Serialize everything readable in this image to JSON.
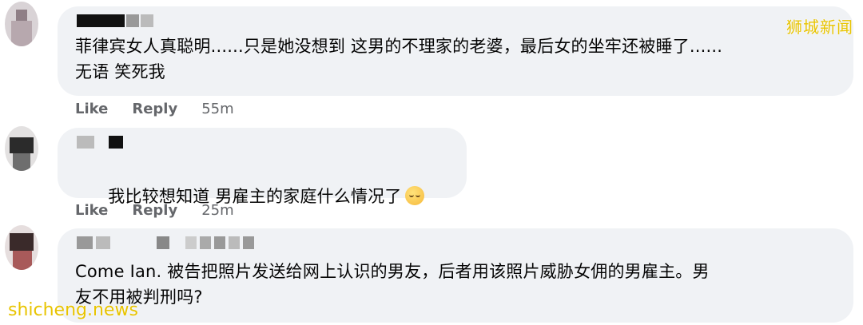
{
  "watermark": {
    "top": "狮城新闻",
    "bottom": "shicheng.news"
  },
  "comments": [
    {
      "text": "菲律宾女人真聪明......只是她没想到 这男的不理家的老婆，最后女的坐牢还被睡了......\n无语 笑死我",
      "actions": {
        "like": "Like",
        "reply": "Reply",
        "time": "55m"
      }
    },
    {
      "text": "我比较想知道 男雇主的家庭什么情况了",
      "emoji": "relieved-face-emoji",
      "actions": {
        "like": "Like",
        "reply": "Reply",
        "time": "25m"
      }
    },
    {
      "text": "Come Ian. 被告把照片发送给网上认识的男友，后者用该照片威胁女佣的男雇主。男\n友不用被判刑吗?"
    }
  ],
  "colors": {
    "bubble": "#f0f2f5",
    "meta": "#65676b",
    "watermark": "#e8c400"
  }
}
